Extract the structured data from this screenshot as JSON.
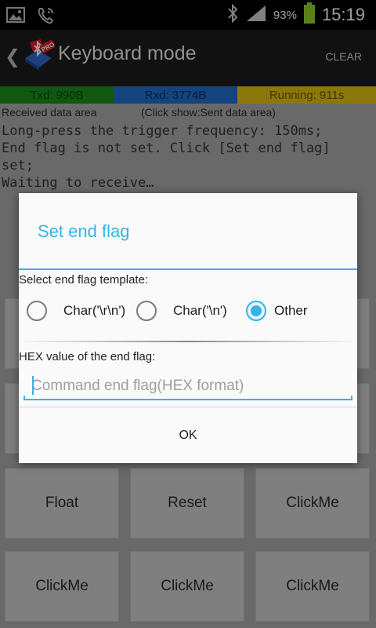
{
  "statusbar": {
    "battery_pct": "93%",
    "clock": "15:19",
    "icons": [
      "image-icon",
      "phone-icon",
      "bluetooth-icon",
      "signal-icon",
      "battery-icon"
    ]
  },
  "actionbar": {
    "title": "Keyboard mode",
    "clear_label": "CLEAR",
    "logo_badge": "PRO"
  },
  "counters": {
    "txd": "Txd: 990B",
    "rxd": "Rxd: 3774B",
    "running": "Running: 911s"
  },
  "data_area": {
    "label": "Received data area",
    "hint": "(Click show:Sent data area)"
  },
  "log": {
    "lines": [
      "Long-press the trigger frequency: 150ms;",
      "End flag is not set. Click [Set end flag]",
      "set;",
      "Waiting to receive…"
    ]
  },
  "keys": {
    "row1": [
      "",
      "",
      ""
    ],
    "row2": [
      "",
      "",
      ""
    ],
    "row3": [
      "Float",
      "Reset",
      "ClickMe"
    ],
    "row4": [
      "ClickMe",
      "ClickMe",
      "ClickMe"
    ]
  },
  "dialog": {
    "title": "Set end flag",
    "template_label": "Select end flag template:",
    "options": [
      {
        "label": "Char('\\r\\n')",
        "checked": false
      },
      {
        "label": "Char('\\n')",
        "checked": false
      },
      {
        "label": "Other",
        "checked": true
      }
    ],
    "hex_label": "HEX value of the end flag:",
    "hex_placeholder": "Command end flag(HEX format)",
    "hex_value": "",
    "ok_label": "OK"
  },
  "colors": {
    "accent": "#33b5e5",
    "txd_bg": "#1a8e1a",
    "rxd_bg": "#1f6fcc",
    "running_bg": "#e2c112"
  }
}
